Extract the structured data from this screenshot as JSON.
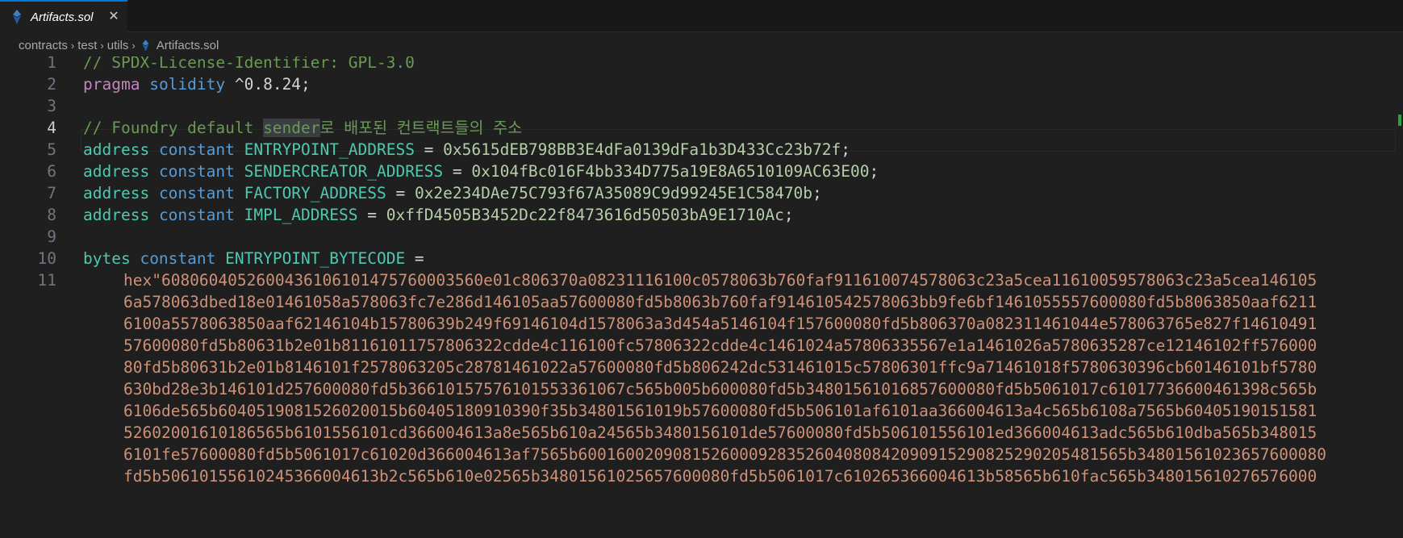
{
  "tab": {
    "file_name": "Artifacts.sol",
    "close_glyph": "✕",
    "icon": "solidity-file-icon"
  },
  "breadcrumb": {
    "parts": [
      "contracts",
      "test",
      "utils"
    ],
    "separator": "›",
    "file": "Artifacts.sol"
  },
  "editor": {
    "active_line": 4,
    "lines": [
      {
        "n": "1",
        "tokens": [
          {
            "t": "// SPDX-License-Identifier: GPL-3.0",
            "c": "c-comment"
          }
        ]
      },
      {
        "n": "2",
        "tokens": [
          {
            "t": "pragma",
            "c": "c-keyword"
          },
          {
            "t": " ",
            "c": "c-plain"
          },
          {
            "t": "solidity",
            "c": "c-blue"
          },
          {
            "t": " ^0.8.24;",
            "c": "c-plain"
          }
        ]
      },
      {
        "n": "3",
        "tokens": []
      },
      {
        "n": "4",
        "tokens": [
          {
            "t": "// Foundry default ",
            "c": "c-comment"
          },
          {
            "t": "sender",
            "c": "c-comment hl-word"
          },
          {
            "t": "로 배포된 컨트랙트들의 주소",
            "c": "c-comment"
          }
        ]
      },
      {
        "n": "5",
        "tokens": [
          {
            "t": "address",
            "c": "c-type"
          },
          {
            "t": " ",
            "c": "c-plain"
          },
          {
            "t": "constant",
            "c": "c-blue"
          },
          {
            "t": " ",
            "c": "c-plain"
          },
          {
            "t": "ENTRYPOINT_ADDRESS",
            "c": "c-type"
          },
          {
            "t": " = ",
            "c": "c-plain"
          },
          {
            "t": "0x5615dEB798BB3E4dFa0139dFa1b3D433Cc23b72f",
            "c": "c-num"
          },
          {
            "t": ";",
            "c": "c-plain"
          }
        ]
      },
      {
        "n": "6",
        "tokens": [
          {
            "t": "address",
            "c": "c-type"
          },
          {
            "t": " ",
            "c": "c-plain"
          },
          {
            "t": "constant",
            "c": "c-blue"
          },
          {
            "t": " ",
            "c": "c-plain"
          },
          {
            "t": "SENDERCREATOR_ADDRESS",
            "c": "c-type"
          },
          {
            "t": " = ",
            "c": "c-plain"
          },
          {
            "t": "0x104fBc016F4bb334D775a19E8A6510109AC63E00",
            "c": "c-num"
          },
          {
            "t": ";",
            "c": "c-plain"
          }
        ]
      },
      {
        "n": "7",
        "tokens": [
          {
            "t": "address",
            "c": "c-type"
          },
          {
            "t": " ",
            "c": "c-plain"
          },
          {
            "t": "constant",
            "c": "c-blue"
          },
          {
            "t": " ",
            "c": "c-plain"
          },
          {
            "t": "FACTORY_ADDRESS",
            "c": "c-type"
          },
          {
            "t": " = ",
            "c": "c-plain"
          },
          {
            "t": "0x2e234DAe75C793f67A35089C9d99245E1C58470b",
            "c": "c-num"
          },
          {
            "t": ";",
            "c": "c-plain"
          }
        ]
      },
      {
        "n": "8",
        "tokens": [
          {
            "t": "address",
            "c": "c-type"
          },
          {
            "t": " ",
            "c": "c-plain"
          },
          {
            "t": "constant",
            "c": "c-blue"
          },
          {
            "t": " ",
            "c": "c-plain"
          },
          {
            "t": "IMPL_ADDRESS",
            "c": "c-type"
          },
          {
            "t": " = ",
            "c": "c-plain"
          },
          {
            "t": "0xffD4505B3452Dc22f8473616d50503bA9E1710Ac",
            "c": "c-num"
          },
          {
            "t": ";",
            "c": "c-plain"
          }
        ]
      },
      {
        "n": "9",
        "tokens": []
      },
      {
        "n": "10",
        "tokens": [
          {
            "t": "bytes",
            "c": "c-type"
          },
          {
            "t": " ",
            "c": "c-plain"
          },
          {
            "t": "constant",
            "c": "c-blue"
          },
          {
            "t": " ",
            "c": "c-plain"
          },
          {
            "t": "ENTRYPOINT_BYTECODE",
            "c": "c-type"
          },
          {
            "t": " =",
            "c": "c-plain"
          }
        ]
      },
      {
        "n": "11",
        "tokens": []
      }
    ],
    "hex_wrapped": [
      "hex\"60806040526004361061014757600035 60e01c806370a08231116100c0578063b760faf911610074578063c23a5cea11610059578063c23a5cea146105",
      "6a578063dbed18e01461058a578063fc7e286d146105aa57600080fd5b8063b760faf914610542578063bb9fe6bf1461055557600080fd5b8063850aaf6211",
      "6100a5578063850aaf62146104b15780639b249f69146104d1578063a3d454a5146104f157600080fd5b806370a082311461044e578063765e827f14610491",
      "57600080fd5b80631b2e01b8116101175780 6322cdde4c116100fc57806322cdde4c1461024a5780633 5567e1a1461026a5780635287ce12146102ff576000",
      "80fd5b80631b2e01b8146101f2578063205c28781461022a57600080fd5b806242dc531461015c57806301ffc9a71461018f5780630396cb60146101bf5780",
      "630bd28e3b146101d257600080fd5b3661015757610155336106 7c565b005b600080fd5b348015610168576000 80fd5b5061017c61017736600461398c565b",
      "6106de565b604051908152602001 5b60405180910390f35b34801561019b57600080fd5b506101af6101aa366004613a4c565b6108a7565b6040519015 1581",
      "52602001610186565b6101556101cd366004613a8e565b610a24565b3480156101de57600080fd5b506101556101ed366004613adc565b610dba565b348015",
      "6101fe57600080fd5b5061017c61020d366004613af7565b600160 0209081526000928352604080842090915290825290205481565b348015610236576000 80",
      "fd5b5061015561024536600461 3b2c565b610e02565b34801561025657600080fd5b5061017c610265366004613b58565b610fac565b348015610276576000"
    ]
  }
}
